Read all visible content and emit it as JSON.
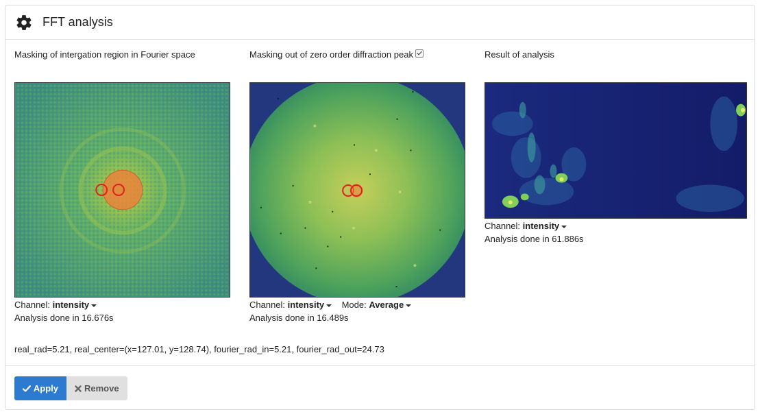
{
  "header": {
    "title": "FFT analysis",
    "icon": "gear-icon"
  },
  "columns": [
    {
      "title": "Masking of intergation region in Fourier space",
      "channel_label": "Channel:",
      "channel_value": "intensity",
      "status": "Analysis done in 16.676s"
    },
    {
      "title": "Masking out of zero order diffraction peak",
      "checkbox_checked": true,
      "channel_label": "Channel:",
      "channel_value": "intensity",
      "mode_label": "Mode:",
      "mode_value": "Average",
      "status": "Analysis done in 16.489s"
    },
    {
      "title": "Result of analysis",
      "channel_label": "Channel:",
      "channel_value": "intensity",
      "status": "Analysis done in 61.886s"
    }
  ],
  "params": "real_rad=5.21, real_center=(x=127.01, y=128.74), fourier_rad_in=5.21, fourier_rad_out=24.73",
  "buttons": {
    "apply": "Apply",
    "remove": "Remove"
  },
  "colors": {
    "accent": "#2d7bd0",
    "mask": "#e02020",
    "viridis_dark": "#1b1d6e",
    "viridis_light": "#9fd04a"
  }
}
